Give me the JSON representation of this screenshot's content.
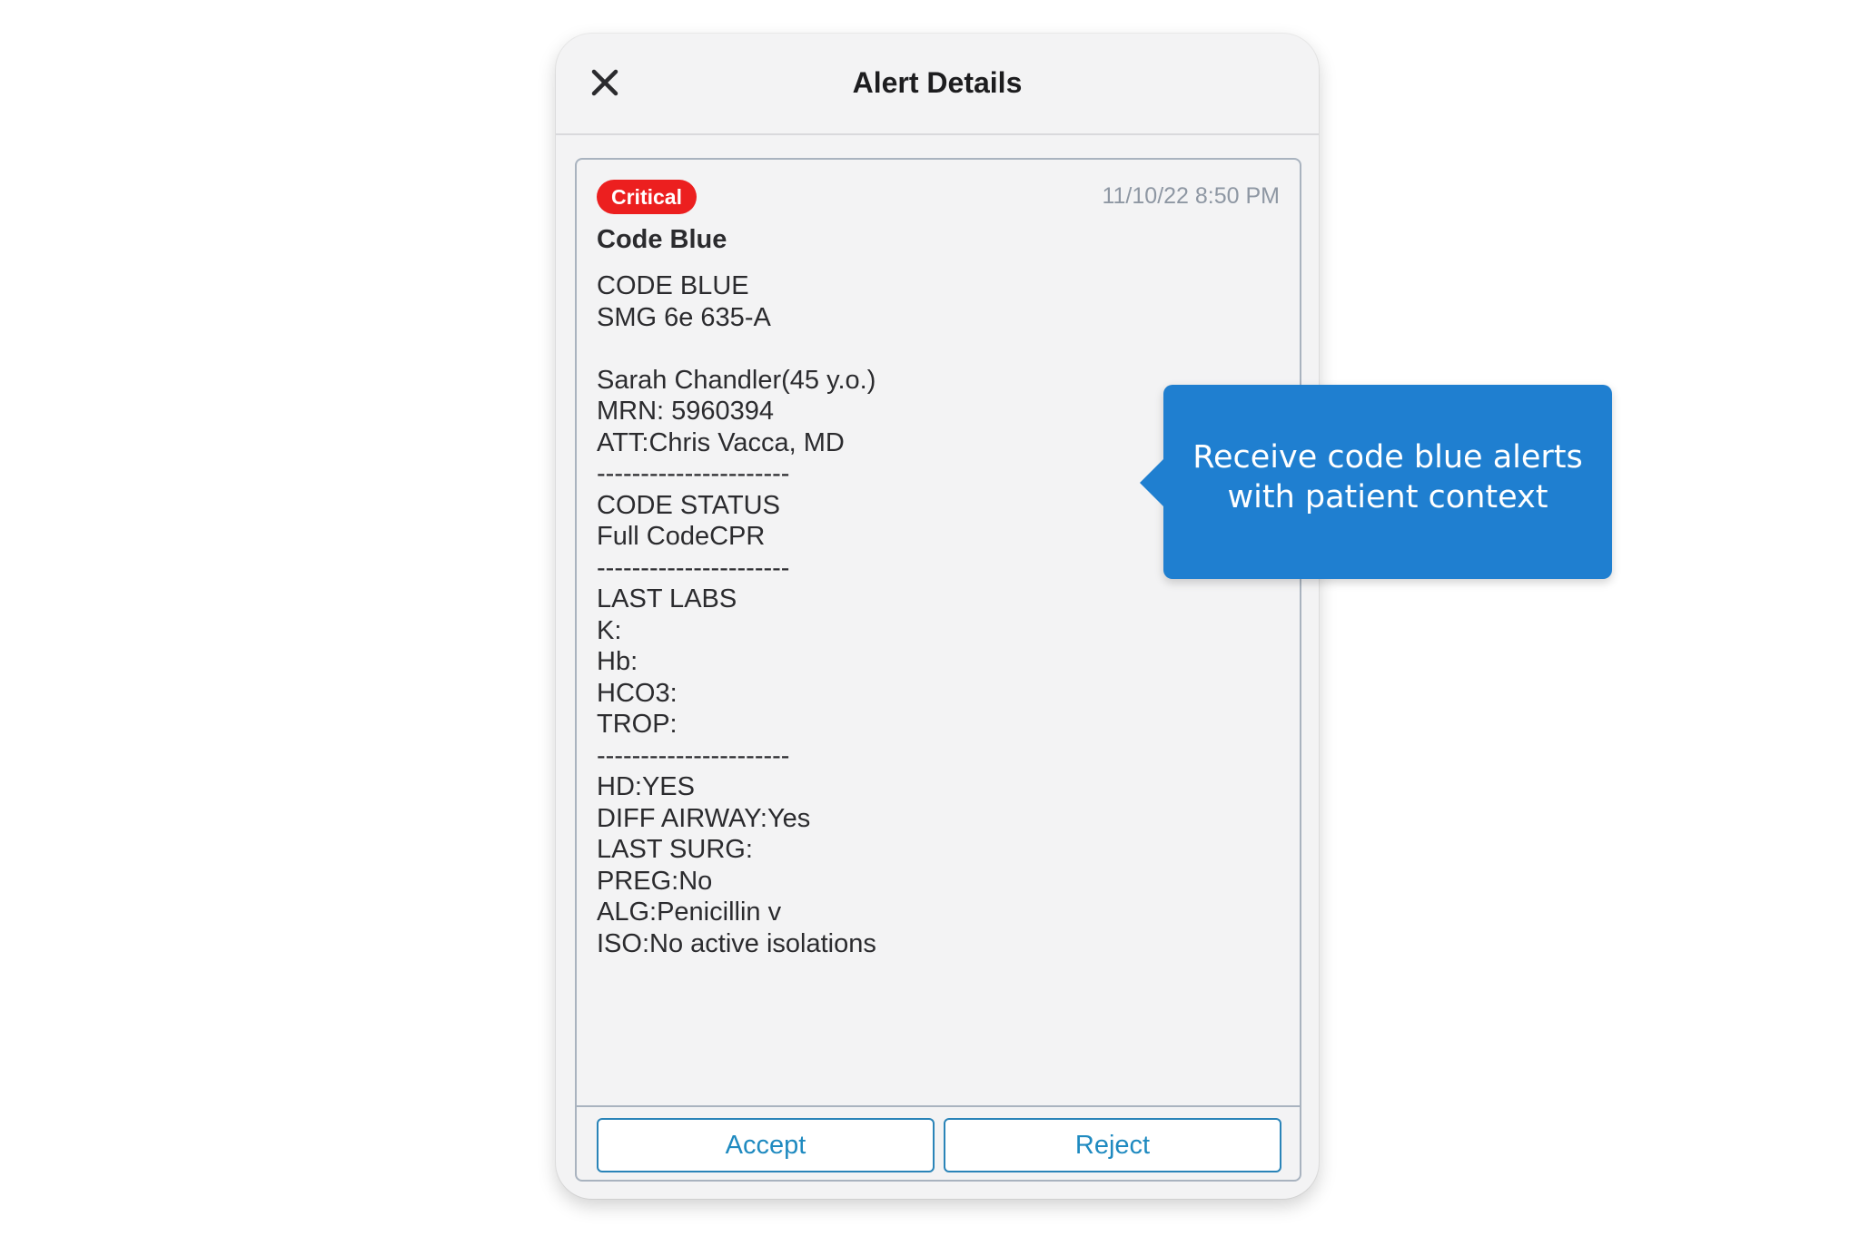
{
  "header": {
    "title": "Alert Details",
    "close_icon": "close-icon"
  },
  "alert": {
    "priority": "Critical",
    "timestamp": "11/10/22 8:50 PM",
    "title": "Code Blue",
    "body_lines": [
      "CODE BLUE",
      "SMG 6e 635-A",
      "",
      "Sarah Chandler(45 y.o.)",
      "MRN: 5960394",
      "ATT:Chris Vacca, MD",
      "----------------------",
      "CODE STATUS",
      "Full CodeCPR",
      "----------------------",
      "LAST LABS",
      "K:",
      "Hb:",
      "HCO3:",
      "TROP:",
      "----------------------",
      "HD:YES",
      "DIFF AIRWAY:Yes",
      "LAST SURG:",
      "PREG:No",
      "ALG:Penicillin v",
      "ISO:No active isolations"
    ]
  },
  "actions": {
    "accept_label": "Accept",
    "reject_label": "Reject"
  },
  "callout": {
    "text": "Receive code blue alerts\nwith patient context"
  },
  "colors": {
    "critical_badge": "#ec1f1f",
    "accent_blue": "#1f7fd0",
    "button_text": "#1f8ac0",
    "timestamp": "#8e97a3"
  }
}
